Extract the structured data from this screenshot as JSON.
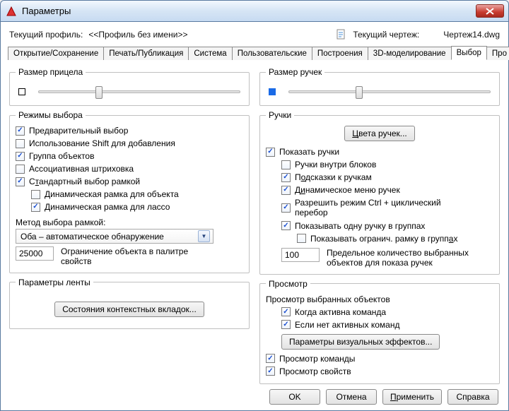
{
  "window": {
    "title": "Параметры"
  },
  "profile": {
    "label": "Текущий профиль:",
    "name": "<<Профиль без имени>>",
    "drawing_label": "Текущий чертеж:",
    "drawing_name": "Чертеж14.dwg"
  },
  "tabs": {
    "open_save": "Открытие/Сохранение",
    "print": "Печать/Публикация",
    "system": "Система",
    "user": "Пользовательские",
    "drafting": "Построения",
    "three_d": "3D-моделирование",
    "selection": "Выбор",
    "pro": "Про"
  },
  "selection_panel": {
    "pickbox": {
      "title": "Размер прицела"
    },
    "modes": {
      "title": "Режимы выбора",
      "preselect": "Предварительный выбор",
      "shift_add": "Использование Shift для добавления",
      "object_group": "Группа объектов",
      "assoc_hatch": "Ассоциативная штриховка",
      "implied_window_prefix": "С",
      "implied_window_accel": "т",
      "implied_window_suffix": "андартный выбор рамкой",
      "dyn_frame_object": "Динамическая рамка для объекта",
      "dyn_frame_lasso": "Динамическая рамка для лассо",
      "method_label": "Метод выбора рамкой:",
      "method_value": "Оба – автоматическое обнаружение",
      "limit_value": "25000",
      "limit_label": "Ограничение объекта в палитре свойств"
    },
    "ribbon": {
      "title": "Параметры ленты",
      "button": "Состояния контекстных вкладок..."
    }
  },
  "grips_panel": {
    "gripsize": {
      "title": "Размер ручек"
    },
    "grips": {
      "title": "Ручки",
      "colors_btn_prefix": "",
      "colors_btn_accel": "Ц",
      "colors_btn_suffix": "вета ручек...",
      "show_grips": "Показать ручки",
      "grips_in_blocks": "Ручки внутри блоков",
      "grip_tips_prefix": "П",
      "grip_tips_accel": "о",
      "grip_tips_suffix": "дсказки к ручкам",
      "dyn_grip_menu_prefix": "Д",
      "dyn_grip_menu_accel": "и",
      "dyn_grip_menu_suffix": "намическое меню ручек",
      "ctrl_cycle": "Разрешить режим Ctrl + циклический перебор",
      "single_grip_groups": "Показывать одну ручку в группах",
      "bbox_groups_prefix": "Показывать огранич. рамку в групп",
      "bbox_groups_accel": "а",
      "bbox_groups_suffix": "х",
      "limit_value": "100",
      "limit_label": "Предельное количество выбранных объектов для показа ручек"
    },
    "preview": {
      "title": "Просмотр",
      "selected_objects": "Просмотр выбранных объектов",
      "cmd_active": "Когда активна команда",
      "no_cmd_active": "Если нет активных команд",
      "visual_btn": "Параметры визуальных эффектов...",
      "command_preview": "Просмотр команды",
      "props_preview": "Просмотр свойств"
    }
  },
  "footer": {
    "ok": "OK",
    "cancel": "Отмена",
    "apply_prefix": "",
    "apply_accel": "П",
    "apply_suffix": "рименить",
    "help": "Справка"
  }
}
